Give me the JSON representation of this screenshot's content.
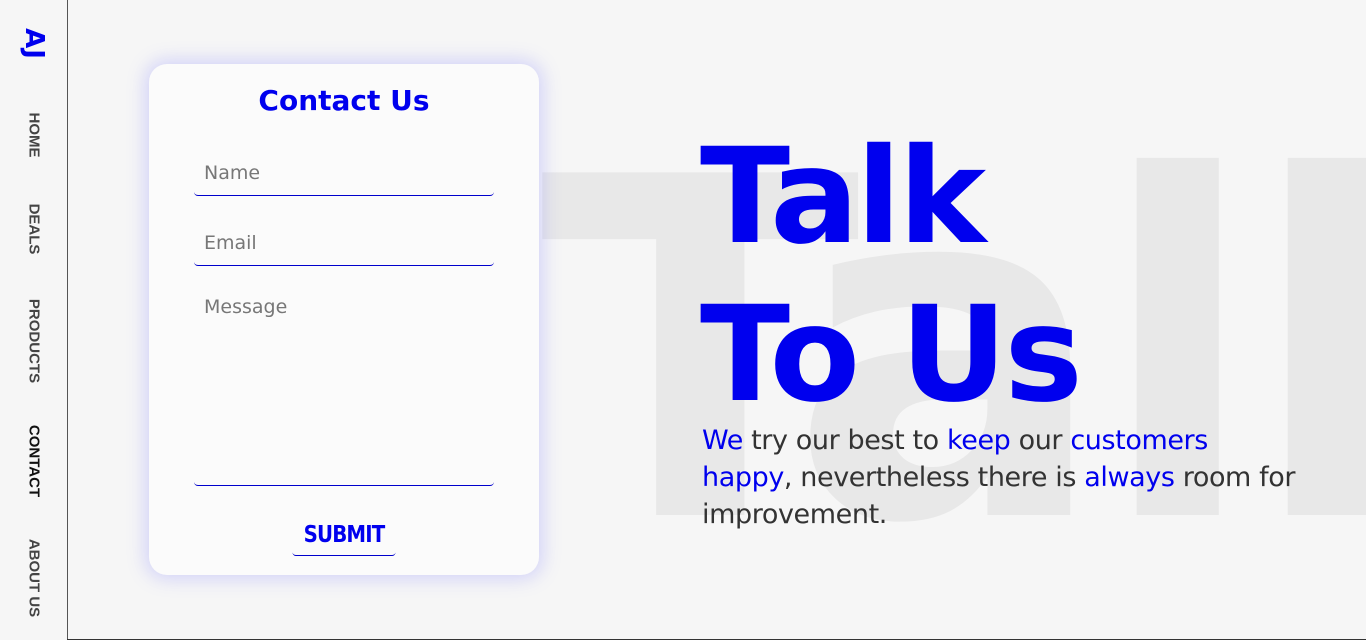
{
  "sidebar": {
    "logo": "AJ",
    "items": [
      {
        "label": "HOME"
      },
      {
        "label": "DEALS"
      },
      {
        "label": "PRODUCTS"
      },
      {
        "label": "CONTACT"
      },
      {
        "label": "ABOUT US"
      }
    ],
    "active_item": "CONTACT"
  },
  "watermark": {
    "text": "Talk"
  },
  "contact_form": {
    "title": "Contact Us",
    "name_placeholder": "Name",
    "email_placeholder": "Email",
    "message_placeholder": "Message",
    "submit_label": "SUBMIT"
  },
  "hero": {
    "line1": "Talk",
    "line2": "To Us"
  },
  "tagline": {
    "segments": [
      {
        "text": "We",
        "highlight": true
      },
      {
        "text": " try our best to ",
        "highlight": false
      },
      {
        "text": "keep",
        "highlight": true
      },
      {
        "text": " our ",
        "highlight": false
      },
      {
        "text": "customers",
        "highlight": true
      },
      {
        "text": " ",
        "highlight": false
      },
      {
        "text": "happy",
        "highlight": true
      },
      {
        "text": ", nevertheless there is ",
        "highlight": false
      },
      {
        "text": "always",
        "highlight": true
      },
      {
        "text": " room for improvement.",
        "highlight": false
      }
    ]
  },
  "colors": {
    "accent": "#0000ee",
    "background": "#f6f6f6",
    "card_background": "#fbfbfb",
    "text": "#333333",
    "watermark": "#e8e8e8"
  }
}
